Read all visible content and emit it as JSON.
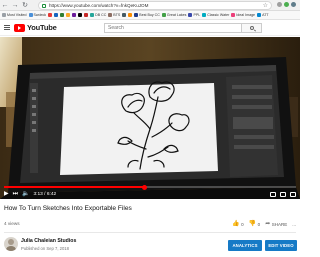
{
  "browser": {
    "url": "https://www.youtube.com/watch?v=fnkQeKuJOM",
    "bookmarks": [
      {
        "label": "Most Visited",
        "color": "#9aa0a6"
      },
      {
        "label": "Swdeck",
        "color": "#4a90d9"
      },
      {
        "label": "",
        "color": "#e53935"
      },
      {
        "label": "",
        "color": "#1565c0"
      },
      {
        "label": "",
        "color": "#2e7d32"
      },
      {
        "label": "",
        "color": "#f9a825"
      },
      {
        "label": "",
        "color": "#6a1b9a"
      },
      {
        "label": "",
        "color": "#000000"
      },
      {
        "label": "",
        "color": "#c62828"
      },
      {
        "label": "DB CC",
        "color": "#26a69a"
      },
      {
        "label": "BTS",
        "color": "#8d6e63"
      },
      {
        "label": "",
        "color": "#455a64"
      },
      {
        "label": "",
        "color": "#fb8c00"
      },
      {
        "label": "Best Buy CC",
        "color": "#1e3a8a"
      },
      {
        "label": "Great Lakes",
        "color": "#43a047"
      },
      {
        "label": "PPL",
        "color": "#3949ab"
      },
      {
        "label": "Classic Water",
        "color": "#00acc1"
      },
      {
        "label": "Ideal Image",
        "color": "#ec407a"
      },
      {
        "label": "ATT",
        "color": "#0288d1"
      }
    ]
  },
  "header": {
    "logo_text": "YouTube",
    "search_placeholder": "Search"
  },
  "player": {
    "time": "3:13 / 6:42",
    "progress": 0.48,
    "brand_color": "#ff0000"
  },
  "video": {
    "title": "How To Turn Sketches Into Exportable Files",
    "views": "4 views",
    "likes": "0",
    "dislikes": "0",
    "share_label": "SHARE",
    "more_label": "..."
  },
  "channel": {
    "name": "Julia Chaleian Studios",
    "published": "Published on Sep 7, 2018"
  },
  "buttons": {
    "analytics": "ANALYTICS",
    "edit_video": "EDIT VIDEO",
    "accent": "#167ac6"
  }
}
